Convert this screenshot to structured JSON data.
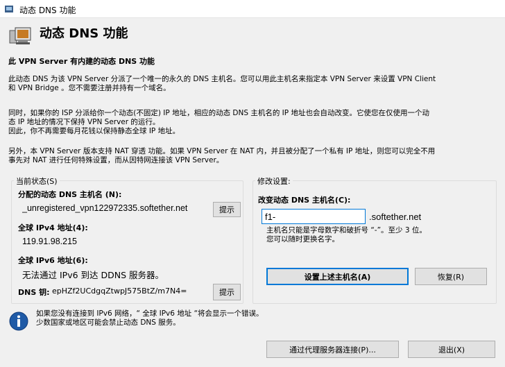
{
  "window": {
    "title": "动态 DNS 功能"
  },
  "header": {
    "title": "动态 DNS 功能"
  },
  "intro": {
    "heading": "此 VPN Server 有内建的动态 DNS 功能",
    "para1_line1": "此动态 DNS 为该 VPN Server 分派了一个唯一的永久的 DNS 主机名。您可以用此主机名来指定本 VPN Server 来设置 VPN Client",
    "para1_line2": "和 VPN Bridge 。您不需要注册并持有一个域名。",
    "para2_line1": "同时，如果你的 ISP 分派给你一个动态(不固定) IP 地址，相应的动态 DNS 主机名的 IP 地址也会自动改变。它使您在仅使用一个动",
    "para2_line2": "态 IP 地址的情况下保持 VPN Server 的运行。",
    "para2_line3": "因此，你不再需要每月花钱以保持静态全球 IP 地址。",
    "para3_line1": "另外，本 VPN Server 版本支持 NAT 穿透 功能。如果 VPN Server 在 NAT 内，并且被分配了一个私有 IP 地址，则您可以完全不用",
    "para3_line2": "事先对 NAT 进行任何特殊设置，而从因特网连接该 VPN Server。"
  },
  "current_status": {
    "legend": "当前状态(S)",
    "hostname_label": "分配的动态 DNS 主机名 (N):",
    "hostname_value": "_unregistered_vpn122972335.softether.net",
    "hostname_button": "提示",
    "ipv4_label": "全球 IPv4 地址(4):",
    "ipv4_value": "119.91.98.215",
    "ipv6_label": "全球 IPv6 地址(6):",
    "ipv6_value": "无法通过 IPv6 到达 DDNS 服务器。",
    "dns_key_label": "DNS 钥:",
    "dns_key_value": "epHZf2UCdgqZtwpJ575BtZ/m7N4=",
    "dns_key_button": "提示"
  },
  "change_settings": {
    "legend": "修改设置:",
    "label": "改变动态 DNS 主机名(C):",
    "input_value": "f1-",
    "suffix": ".softether.net",
    "hint_line1": "主机名只能是字母数字和破折号 “-”。至少 3 位。",
    "hint_line2": "您可以随时更换名字。",
    "set_button": "设置上述主机名(A)",
    "restore_button": "恢复(R)"
  },
  "footer": {
    "note_line1": "如果您没有连接到 IPv6 网络，“ 全球 IPv6 地址 “将会显示一个错误。",
    "note_line2": "少数国家或地区可能会禁止动态 DNS 服务。",
    "proxy_button": "通过代理服务器连接(P)...",
    "exit_button": "退出(X)"
  }
}
